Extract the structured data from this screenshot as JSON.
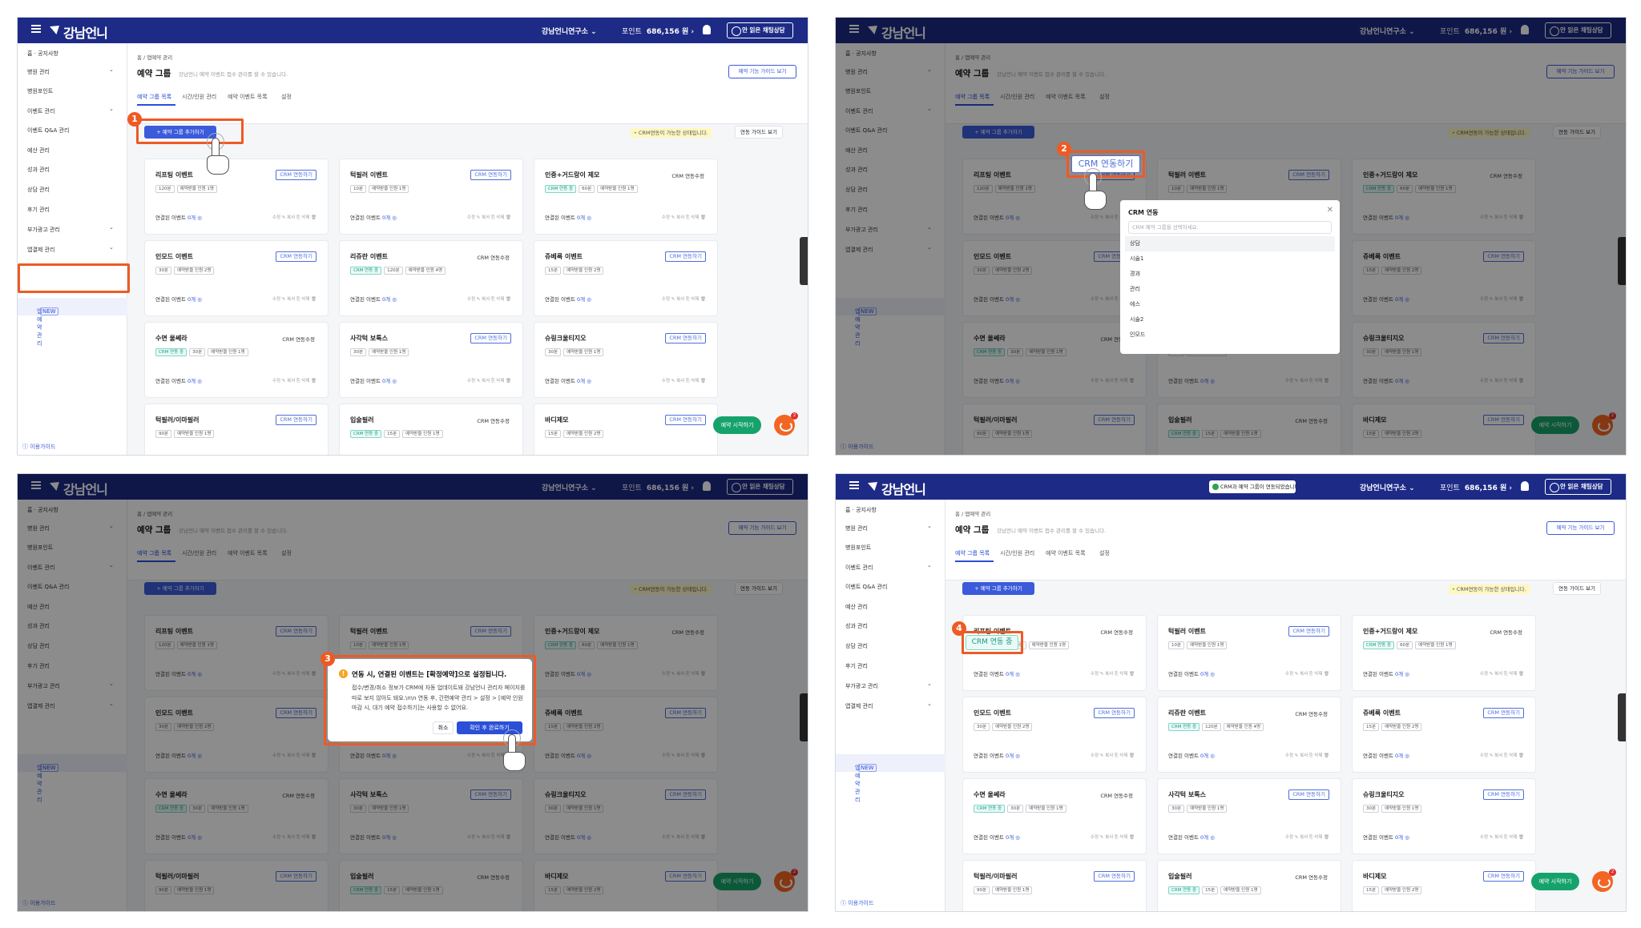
{
  "topbar": {
    "logo": "강남언니",
    "org": "강남언니연구소 ⌄",
    "point_label": "포인트",
    "point_value": "686,156 원 ›",
    "consult": "안 읽은 채팅상담",
    "toast": "CRM과 예약 그룹이 연동되었습니다."
  },
  "sidebar": {
    "items": [
      {
        "label": "홈 · 공지사항",
        "chevron": false
      },
      {
        "label": "병원 관리",
        "chevron": true
      },
      {
        "label": "병원포인트",
        "chevron": false
      },
      {
        "label": "이벤트 관리",
        "chevron": true
      },
      {
        "label": "이벤트 Q&A 관리",
        "chevron": false
      },
      {
        "label": "예산 관리",
        "chevron": false
      },
      {
        "label": "성과 관리",
        "chevron": false
      },
      {
        "label": "상담 관리",
        "chevron": false
      },
      {
        "label": "후기 관리",
        "chevron": false
      },
      {
        "label": "부가광고 관리",
        "chevron": true
      },
      {
        "label": "앱결제 관리",
        "chevron": true
      }
    ],
    "active": "앱예약 관리",
    "new_badge": "NEW",
    "guide": "이용가이드"
  },
  "header": {
    "breadcrumb": "홈 / 앱예약 관리",
    "title": "예약 그룹",
    "desc": "강남언니 예약 이벤트 접수 관리를 할 수 있습니다.",
    "guide_button": "예약 기능 가이드 보기",
    "tabs": [
      "예약 그룹 목록",
      "시간/인원 관리",
      "예약 이벤트 목록",
      "설정"
    ]
  },
  "toolbar": {
    "add_button": "+ 예약 그룹 추가하기",
    "notice": "CRM연동이 가능한 상태입니다.",
    "view_guide": "연동 가이드 보기"
  },
  "card_labels": {
    "crm_connect": "CRM 연동하기",
    "crm_edit": "CRM 연동수정",
    "crm_on": "CRM 연동 중",
    "linked_prefix": "연결된 이벤트",
    "linked_count": "0개 ◎",
    "actions": "수정 ✎  복사 ⎘  삭제 🗑"
  },
  "cards": [
    {
      "title": "리프팅 이벤트",
      "crm": false,
      "tags": [
        "120분",
        "예약받을 인원 1명"
      ]
    },
    {
      "title": "턱필러 이벤트",
      "crm": false,
      "tags": [
        "10분",
        "예약받을 인원 1명"
      ]
    },
    {
      "title": "인중+거드랑이 제모",
      "crm": true,
      "tags": [
        "CRM 연동 중",
        "60분",
        "예약받을 인원 1명"
      ]
    },
    {
      "title": "인모드 이벤트",
      "crm": false,
      "tags": [
        "30분",
        "예약받을 인원 2명"
      ]
    },
    {
      "title": "리쥬란 이벤트",
      "crm": true,
      "tags": [
        "CRM 연동 중",
        "120분",
        "예약받을 인원 4명"
      ]
    },
    {
      "title": "쥬베룩 이벤트",
      "crm": false,
      "tags": [
        "15분",
        "예약받을 인원 2명"
      ]
    },
    {
      "title": "수면 울쎄라",
      "crm": true,
      "tags": [
        "CRM 연동 중",
        "30분",
        "예약받을 인원 1명"
      ]
    },
    {
      "title": "사각턱 보톡스",
      "crm": false,
      "tags": [
        "30분",
        "예약받을 인원 1명"
      ]
    },
    {
      "title": "슈링크울티지오",
      "crm": false,
      "tags": [
        "30분",
        "예약받을 인원 1명"
      ]
    },
    {
      "title": "턱필러/이마필러",
      "crm": false,
      "tags": [
        "90분",
        "예약받을 인원 1명"
      ]
    },
    {
      "title": "입술필러",
      "crm": true,
      "tags": [
        "CRM 연동 중",
        "15분",
        "예약받을 인원 1명"
      ]
    },
    {
      "title": "바디제모",
      "crm": false,
      "tags": [
        "15분",
        "예약받을 인원 2명"
      ]
    }
  ],
  "floating": {
    "start": "예약 시작하기",
    "badge": "2"
  },
  "crm_modal": {
    "title": "CRM 연동",
    "placeholder": "CRM 예약 그룹을 선택하세요.",
    "options": [
      "상담",
      "시술1",
      "경과",
      "관리",
      "에스",
      "시술2",
      "인모드"
    ]
  },
  "confirm_modal": {
    "title": "연동 시, 연결된 이벤트는 [확정예약]으로 설정됩니다.",
    "body": "접수/변경/취소 정보가 CRM에 자동 업데이트돼 강남언니 관리자 페이지를 따로 보지 않아도 돼요.\\n\\n 연동 후, 간편예약 관리 > 설정 > [예약 인원 마감 시, 대기 예약 접수하기]는 사용할 수 없어요.",
    "cancel": "취소",
    "ok": "확인 후 완료하기"
  },
  "steps": [
    "1",
    "2",
    "3",
    "4"
  ],
  "colors": {
    "topbar": "#1d2b86",
    "primary": "#3b5bdb",
    "highlight": "#ee5a24",
    "crm_on": "#1a9b84"
  }
}
